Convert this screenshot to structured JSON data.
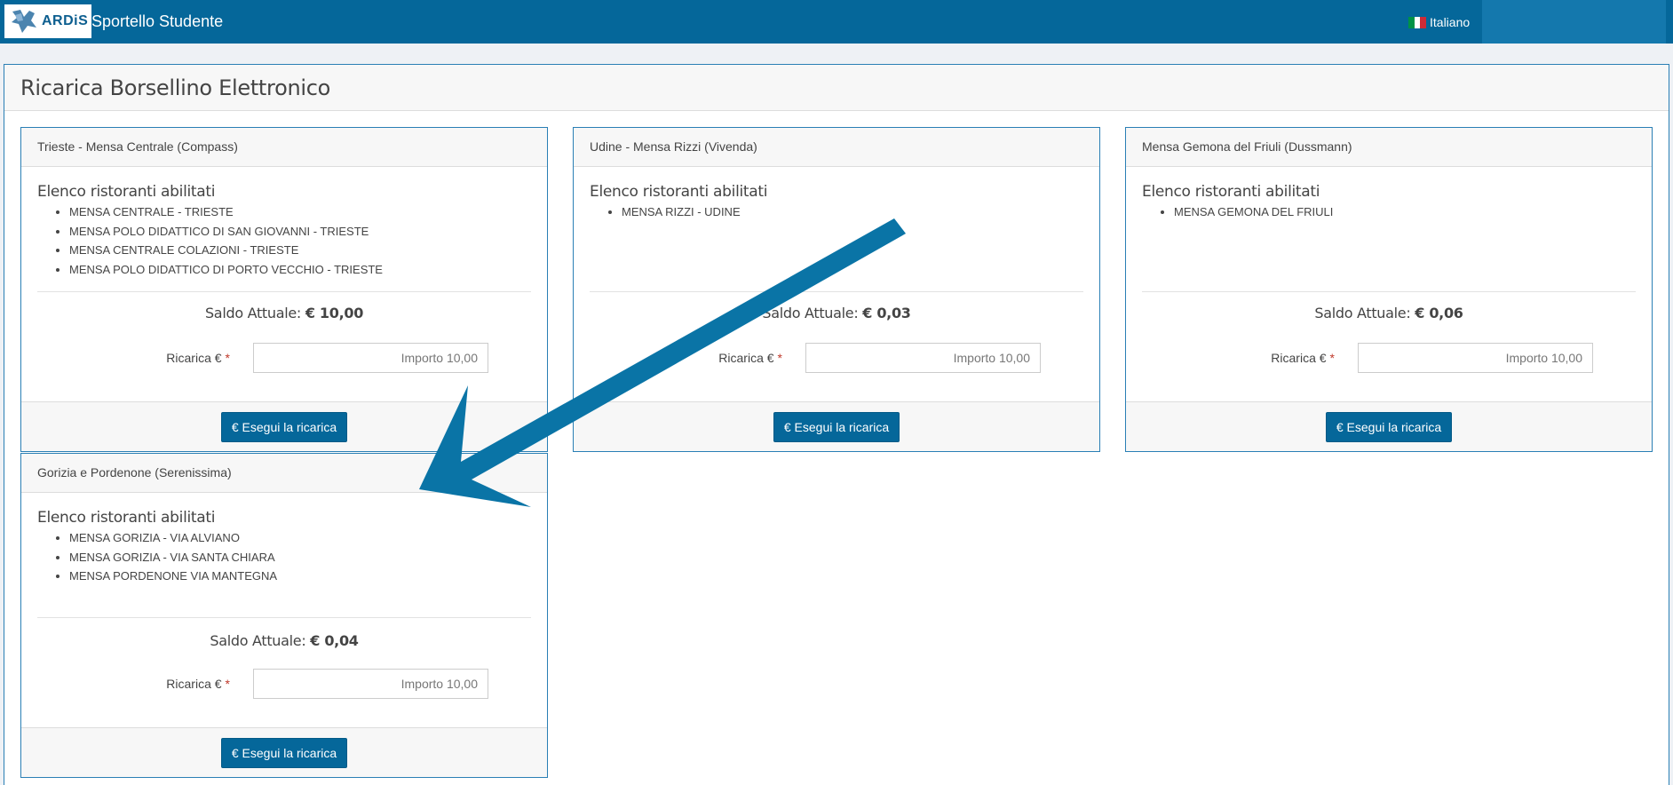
{
  "header": {
    "logo_text": "ARDiS",
    "app_title": "Sportello Studente",
    "language": "Italiano"
  },
  "page": {
    "title": "Ricarica Borsellino Elettronico"
  },
  "common": {
    "list_title": "Elenco ristoranti abilitati",
    "saldo_label": "Saldo Attuale:",
    "ricarica_label": "Ricarica €",
    "required_mark": "*",
    "amount_placeholder": "Importo 10,00",
    "button_label": "€ Esegui la ricarica"
  },
  "cards": [
    {
      "title": "Trieste - Mensa Centrale (Compass)",
      "restaurants": [
        "MENSA CENTRALE - TRIESTE",
        "MENSA POLO DIDATTICO DI SAN GIOVANNI - TRIESTE",
        "MENSA CENTRALE COLAZIONI - TRIESTE",
        "MENSA POLO DIDATTICO DI PORTO VECCHIO - TRIESTE"
      ],
      "saldo": "€ 10,00"
    },
    {
      "title": "Udine - Mensa Rizzi (Vivenda)",
      "restaurants": [
        "MENSA RIZZI - UDINE"
      ],
      "saldo": "€ 0,03"
    },
    {
      "title": "Mensa Gemona del Friuli (Dussmann)",
      "restaurants": [
        "MENSA GEMONA DEL FRIULI"
      ],
      "saldo": "€ 0,06"
    },
    {
      "title": "Gorizia e Pordenone (Serenissima)",
      "restaurants": [
        "MENSA GORIZIA - VIA ALVIANO",
        "MENSA GORIZIA - VIA SANTA CHIARA",
        "MENSA PORDENONE VIA MANTEGNA"
      ],
      "saldo": "€ 0,04"
    }
  ],
  "colors": {
    "brand": "#05679a",
    "annotation_arrow": "#0a74a6"
  }
}
